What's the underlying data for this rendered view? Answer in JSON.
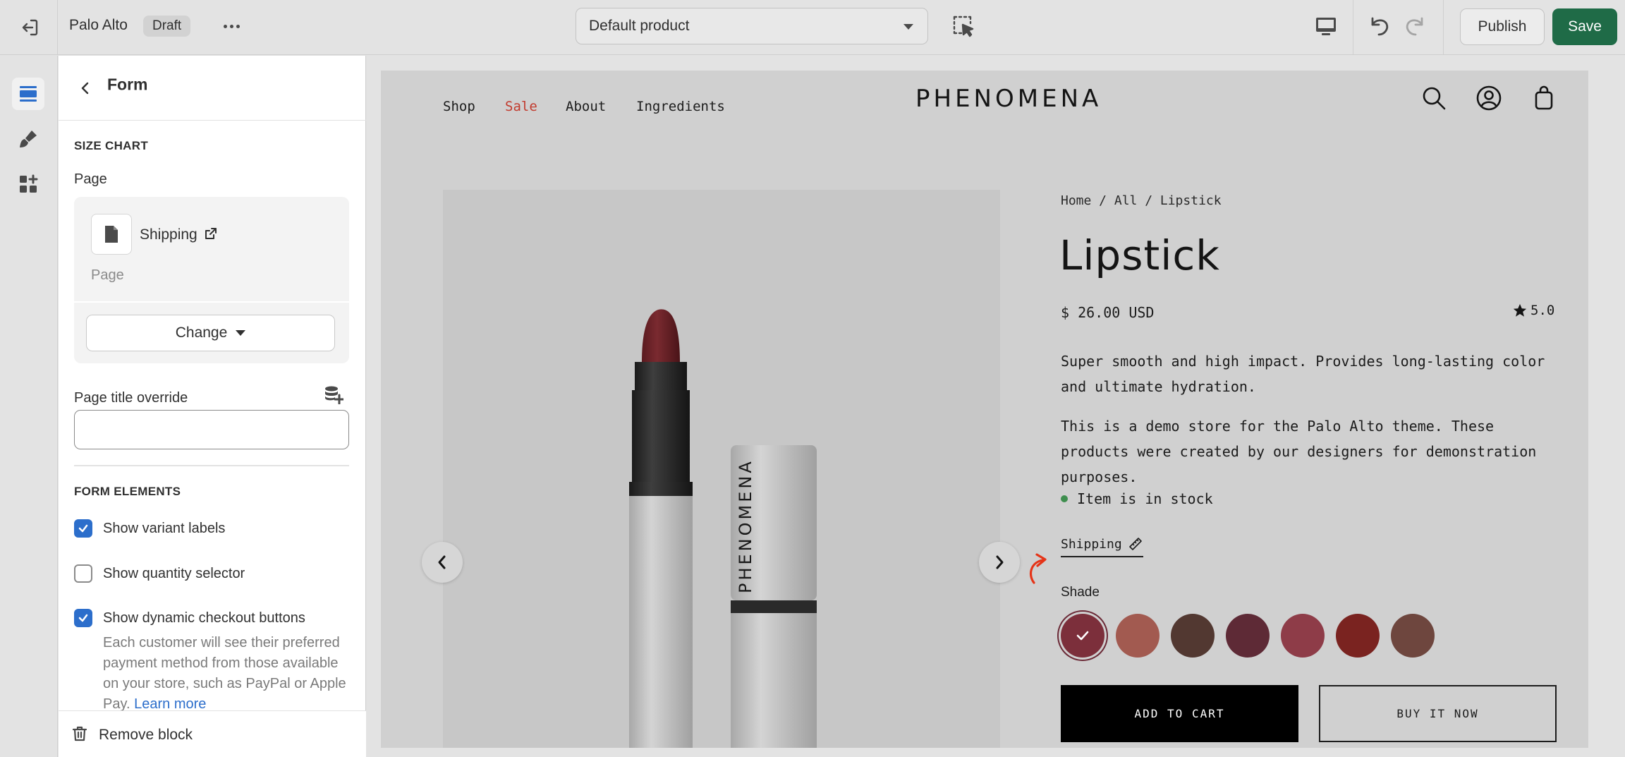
{
  "topbar": {
    "store_name": "Palo Alto",
    "status_badge": "Draft",
    "template_select": "Default product",
    "publish_label": "Publish",
    "save_label": "Save"
  },
  "panel": {
    "title": "Form",
    "size_chart_heading": "SIZE CHART",
    "page_label": "Page",
    "selected_page_name": "Shipping",
    "selected_page_type": "Page",
    "change_label": "Change",
    "page_title_override_label": "Page title override",
    "page_title_override_value": "",
    "form_elements_heading": "FORM ELEMENTS",
    "checkboxes": [
      {
        "label": "Show variant labels",
        "checked": true
      },
      {
        "label": "Show quantity selector",
        "checked": false
      },
      {
        "label": "Show dynamic checkout buttons",
        "checked": true
      }
    ],
    "checkout_help_text": "Each customer will see their preferred payment method from those available on your store, such as PayPal or Apple Pay.",
    "learn_more_label": "Learn more",
    "remove_block_label": "Remove block"
  },
  "preview": {
    "nav": [
      "Shop",
      "Sale",
      "About",
      "Ingredients"
    ],
    "logo": "PHENOMENA",
    "product_logo_text": "PHENOMENA",
    "breadcrumb": "Home / All / Lipstick",
    "product_title": "Lipstick",
    "price": "$ 26.00 USD",
    "rating": "5.0",
    "description": [
      "Super smooth and high impact. Provides long-lasting color and ultimate hydration.",
      "This is a demo store for the Palo Alto theme. These products were created by our designers for demonstration purposes."
    ],
    "stock_status": "Item is in stock",
    "shipping_link": "Shipping",
    "shade_label": "Shade",
    "shades": [
      "#7c2f3b",
      "#a25a50",
      "#523831",
      "#5e2a36",
      "#8e3c48",
      "#7a2320",
      "#6e463e"
    ],
    "selected_shade": 0,
    "add_to_cart_label": "ADD TO CART",
    "buy_now_label": "BUY IT NOW"
  },
  "colors": {
    "accent_green": "#1f6b47",
    "checkbox_blue": "#2c6ecb",
    "sale_red": "#c23b2e",
    "stock_green": "#3e8e4e"
  }
}
